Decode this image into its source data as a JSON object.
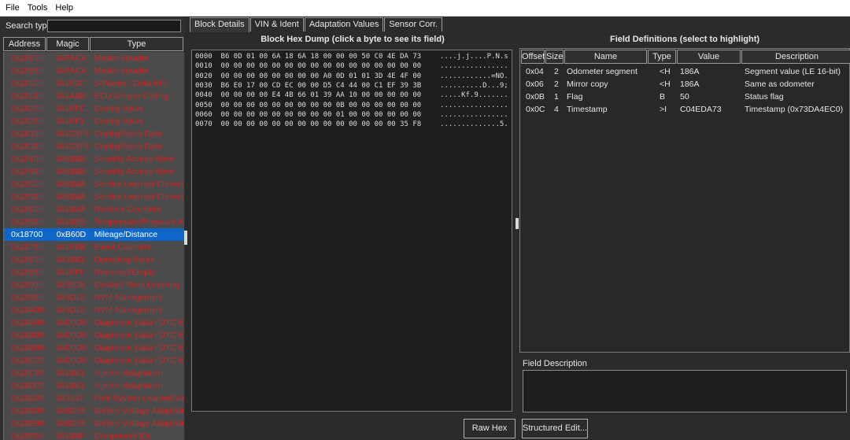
{
  "menu": [
    "File",
    "Tools",
    "Help"
  ],
  "search": {
    "label": "Search type:",
    "value": ""
  },
  "list": {
    "headers": {
      "address": "Address",
      "magic": "Magic",
      "type": "Type"
    },
    "rows": [
      {
        "address": "0x18800",
        "magic": "0xFACA",
        "type": "Master Header",
        "state": "bad"
      },
      {
        "address": "0x18880",
        "magic": "0xFACA",
        "type": "Master Header",
        "state": "bad"
      },
      {
        "address": "0x18100",
        "magic": "0x1F3C",
        "type": "Software / Data Info",
        "state": "bad"
      },
      {
        "address": "0x18180",
        "magic": "0x1A8B",
        "type": "ECU Unique Coding",
        "state": "bad"
      },
      {
        "address": "0x18200",
        "magic": "0x1FFC",
        "type": "Coding Value",
        "state": "bad"
      },
      {
        "address": "0x18280",
        "magic": "0x1FF1",
        "type": "Coding Value",
        "state": "bad"
      },
      {
        "address": "0x18300",
        "magic": "0x1C8FF",
        "type": "Coding/Seed Data",
        "state": "bad"
      },
      {
        "address": "0x18380",
        "magic": "0x1C8FF",
        "type": "Coding/Seed Data",
        "state": "bad"
      },
      {
        "address": "0x18400",
        "magic": "0x8B8B",
        "type": "Security Access Seed",
        "state": "bad"
      },
      {
        "address": "0x18480",
        "magic": "0x8B8B",
        "type": "Security Access Seed",
        "state": "bad"
      },
      {
        "address": "0x18500",
        "magic": "0x8B8A",
        "type": "Service Learned Correction",
        "state": "bad"
      },
      {
        "address": "0x18580",
        "magic": "0x8B8A",
        "type": "Service Learned Correction",
        "state": "bad"
      },
      {
        "address": "0x18600",
        "magic": "0x1BAF",
        "type": "Runtime Counters",
        "state": "bad"
      },
      {
        "address": "0x18680",
        "magic": "0x1BB5",
        "type": "Temperature/Pressure Adap",
        "state": "bad"
      },
      {
        "address": "0x18700",
        "magic": "0xB60D",
        "type": "Mileage/Distance",
        "state": "sel"
      },
      {
        "address": "0x18780",
        "magic": "0x1F6B",
        "type": "Event Counters",
        "state": "bad"
      },
      {
        "address": "0x18800",
        "magic": "0x3B81",
        "type": "Operating Hours",
        "state": "bad"
      },
      {
        "address": "0x18880",
        "magic": "0x1FFF",
        "type": "Reserved/Empty",
        "state": "bad"
      },
      {
        "address": "0x18900",
        "magic": "0x980B",
        "type": "Coolant Temp Learning",
        "state": "bad"
      },
      {
        "address": "0x18980",
        "magic": "0x9D10",
        "type": "NVM Management",
        "state": "bad"
      },
      {
        "address": "0x18A00",
        "magic": "0x9D10",
        "type": "NVM Management",
        "state": "bad"
      },
      {
        "address": "0x18A80",
        "magic": "0xD0D0",
        "type": "Diagnostic Data / DTC Erase",
        "state": "bad"
      },
      {
        "address": "0x18B00",
        "magic": "0xD0D0",
        "type": "Diagnostic Data / DTC Erase",
        "state": "bad"
      },
      {
        "address": "0x18B80",
        "magic": "0xD0D0",
        "type": "Diagnostic Data / DTC Erase",
        "state": "bad"
      },
      {
        "address": "0x18C00",
        "magic": "0xD0D0",
        "type": "Diagnostic Data / DTC Erase",
        "state": "bad"
      },
      {
        "address": "0x18C80",
        "magic": "0x1B41",
        "type": "Injector Adaptation",
        "state": "bad"
      },
      {
        "address": "0x18D00",
        "magic": "0x1B41",
        "type": "Injector Adaptation",
        "state": "bad"
      },
      {
        "address": "0x18D80",
        "magic": "0x3157",
        "type": "Fuel System Learned Values",
        "state": "bad"
      },
      {
        "address": "0x18E00",
        "magic": "0xBE56",
        "type": "Battery Voltage Adaptation",
        "state": "bad"
      },
      {
        "address": "0x18E80",
        "magic": "0xBE56",
        "type": "Battery Voltage Adaptation",
        "state": "bad"
      },
      {
        "address": "0x18F00",
        "magic": "0x1B8F",
        "type": "Component IDs",
        "state": "bad"
      }
    ]
  },
  "tabs": [
    "Block Details",
    "VIN & Ident",
    "Adaptation Values",
    "Sensor Corr."
  ],
  "hex": {
    "title": "Block Hex Dump (click a byte to see its field)",
    "lines": [
      {
        "off": "0000",
        "bytes": "B6 0D 01 00 6A 18 6A 18 00 00 00 50 C0 4E DA 73",
        "ascii": "....j.j....P.N.s"
      },
      {
        "off": "0010",
        "bytes": "00 00 00 00 00 00 00 00 00 00 00 00 00 00 00 00",
        "ascii": "................"
      },
      {
        "off": "0020",
        "bytes": "00 00 00 00 00 00 00 00 A0 0D 01 01 3D 4E 4F 00",
        "ascii": "............=NO."
      },
      {
        "off": "0030",
        "bytes": "B6 E0 17 00 CD EC 00 00 D5 C4 44 00 C1 EF 39 3B",
        "ascii": "..........D...9;"
      },
      {
        "off": "0040",
        "bytes": "00 00 00 00 E4 4B 66 01 39 AA 10 00 00 00 00 00",
        "ascii": ".....Kf.9......."
      },
      {
        "off": "0050",
        "bytes": "00 00 00 00 00 00 00 00 00 0B 00 00 00 00 00 00",
        "ascii": "................"
      },
      {
        "off": "0060",
        "bytes": "00 00 00 00 00 00 00 00 00 01 00 00 00 00 00 00",
        "ascii": "................"
      },
      {
        "off": "0070",
        "bytes": "00 00 00 00 00 00 00 00 00 00 00 00 00 00 35 F8",
        "ascii": "..............5."
      }
    ]
  },
  "fields": {
    "title": "Field Definitions (select to highlight)",
    "headers": {
      "offset": "Offset",
      "size": "Size",
      "name": "Name",
      "type": "Type",
      "value": "Value",
      "desc": "Description"
    },
    "rows": [
      {
        "offset": "0x04",
        "size": "2",
        "name": "Odometer segment",
        "type": "<H",
        "value": "186A",
        "desc": "Segment value (LE 16-bit)"
      },
      {
        "offset": "0x06",
        "size": "2",
        "name": "Mirror copy",
        "type": "<H",
        "value": "186A",
        "desc": "Same as odometer"
      },
      {
        "offset": "0x0B",
        "size": "1",
        "name": "Flag",
        "type": "B",
        "value": "50",
        "desc": "Status flag"
      },
      {
        "offset": "0x0C",
        "size": "4",
        "name": "Timestamp",
        "type": ">I",
        "value": "C04EDA73",
        "desc": "Timestamp (0x73DA4EC0)"
      }
    ]
  },
  "field_description": {
    "label": "Field Description",
    "value": ""
  },
  "buttons": {
    "raw": "Raw Hex Edit",
    "structured": "Structured Edit..."
  }
}
